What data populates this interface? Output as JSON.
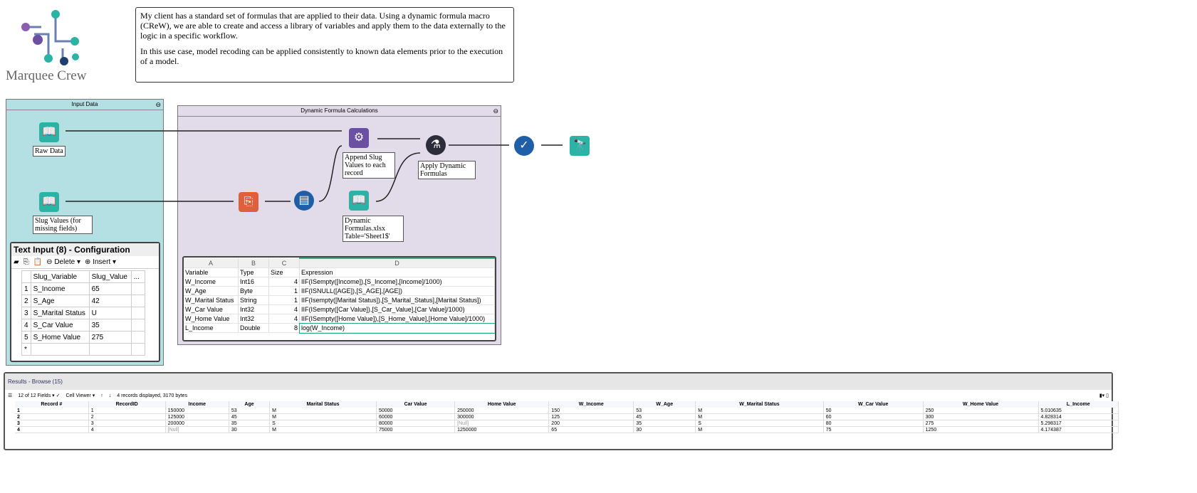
{
  "logo": {
    "text": "Marquee Crew"
  },
  "note": {
    "p1": "My client has a standard set of formulas that are applied to their data.  Using a dynamic formula macro (CReW), we are able to create and access a library of variables and apply them to the data externally to the logic in a specific workflow.",
    "p2": "In this use case, model recoding can be applied consistently to known data elements prior to the execution of a model."
  },
  "input_container": {
    "title": "Input Data",
    "tools": [
      {
        "label": "Raw Data"
      },
      {
        "label": "Slug Values (for missing fields)"
      }
    ]
  },
  "formula_container": {
    "title": "Dynamic Formula Calculations",
    "tools": [
      {
        "label": "Append Slug Values to each record"
      },
      {
        "label": "Apply Dynamic Formulas"
      },
      {
        "label": "Dynamic Formulas.xlsx Table='Sheet1$'"
      }
    ]
  },
  "config": {
    "title": "Text Input (8) - Configuration",
    "delete": "Delete",
    "insert": "Insert",
    "headers": [
      "Slug_Variable",
      "Slug_Value",
      "..."
    ],
    "rows": [
      [
        "1",
        "S_Income",
        "65"
      ],
      [
        "2",
        "S_Age",
        "42"
      ],
      [
        "3",
        "S_Marital Status",
        "U"
      ],
      [
        "4",
        "S_Car Value",
        "35"
      ],
      [
        "5",
        "S_Home Value",
        "275"
      ],
      [
        "*",
        "",
        ""
      ]
    ]
  },
  "sheet": {
    "cols": [
      "A",
      "B",
      "C",
      "D"
    ],
    "rows": [
      [
        "Variable",
        "Type",
        "Size",
        "Expression"
      ],
      [
        "W_Income",
        "Int16",
        "4",
        "IIF(ISempty([Income]),[S_Income],[Income]/1000)"
      ],
      [
        "W_Age",
        "Byte",
        "1",
        "IIF(ISNULL([AGE]),[S_AGE],[AGE])"
      ],
      [
        "W_Marital Status",
        "String",
        "1",
        "IIF(Isempty([Marital Status]),[S_Marital_Status],[Marital Status])"
      ],
      [
        "W_Car Value",
        "Int32",
        "4",
        "IIF(ISempty([Car Value]),[S_Car_Value],[Car Value]/1000)"
      ],
      [
        "W_Home Value",
        "Int32",
        "4",
        "IIF(ISempty([Home Value]),[S_Home_Value],[Home Value]/1000)"
      ],
      [
        "L_Income",
        "Double",
        "8",
        "log(W_Income)"
      ]
    ]
  },
  "results": {
    "title": "Results - Browse (15)",
    "fields": "12 of 12 Fields",
    "viewer": "Cell Viewer",
    "status": "4 records displayed, 3170 bytes",
    "headers": [
      "Record #",
      "RecordID",
      "Income",
      "Age",
      "Marital Status",
      "Car Value",
      "Home Value",
      "W_Income",
      "W_Age",
      "W_Marital Status",
      "W_Car Value",
      "W_Home Value",
      "L_Income"
    ],
    "rows": [
      [
        "1",
        "1",
        "150000",
        "53",
        "M",
        "50000",
        "250000",
        "150",
        "53",
        "M",
        "50",
        "250",
        "5.010635"
      ],
      [
        "2",
        "2",
        "125000",
        "45",
        "M",
        "60000",
        "300000",
        "125",
        "45",
        "M",
        "60",
        "300",
        "4.828314"
      ],
      [
        "3",
        "3",
        "200000",
        "35",
        "S",
        "80000",
        "[Null]",
        "200",
        "35",
        "S",
        "80",
        "275",
        "5.298317"
      ],
      [
        "4",
        "4",
        "[Null]",
        "30",
        "M",
        "75000",
        "1250000",
        "65",
        "30",
        "M",
        "75",
        "1250",
        "4.174387"
      ]
    ]
  },
  "colors": {
    "input_bg": "#b5e0e3",
    "formula_bg": "#e2dcea",
    "teal": "#2bb3a6",
    "purple": "#6b4fa0",
    "blue": "#1f5fa8",
    "red": "#e0603e"
  }
}
